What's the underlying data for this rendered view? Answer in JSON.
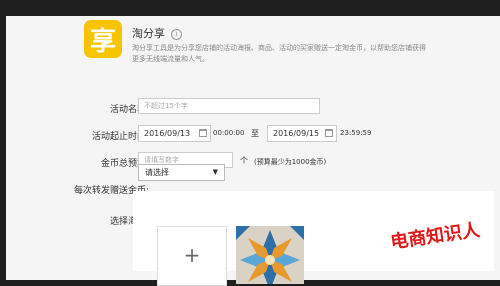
{
  "app": {
    "icon_char": "享",
    "title": "淘分享",
    "info_icon": "ⓘ",
    "description": "淘分享工具是为分享您店铺的活动海报、商品、活动的买家赠送一定淘金币，以帮助您店铺获得更多无线端流量和人气。"
  },
  "form": {
    "activity_name": {
      "label": "活动名称:",
      "placeholder": "不超过15个字"
    },
    "time": {
      "label": "活动起止时间:",
      "start_date": "2016/09/13",
      "start_time": "00:00:00",
      "separator": "至",
      "end_date": "2016/09/15",
      "end_time": "23:59:59"
    },
    "budget": {
      "label": "金币总预算:",
      "placeholder": "请填写数字",
      "unit": "个",
      "hint": "(预算最少为1000金币)"
    },
    "per_share": {
      "label": "每次转发赠送金币:",
      "selected": "请选择",
      "caret": "▼"
    },
    "poster": {
      "label": "选择海报:",
      "add_symbol": "+"
    }
  },
  "watermark": "电商知识人",
  "colors": {
    "icon_bg": "#f6c400",
    "watermark": "#e01818"
  }
}
